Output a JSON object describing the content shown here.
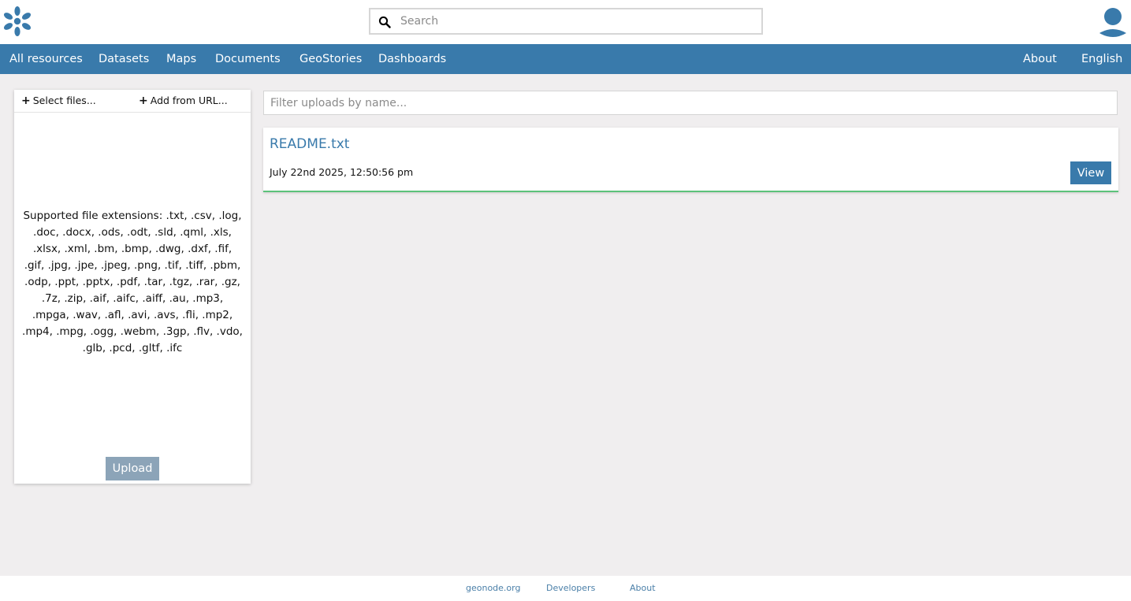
{
  "header": {
    "logo_icon": "geonode-logo-icon",
    "search_placeholder": "Search",
    "search_icon": "search-icon",
    "user_icon": "user-avatar-icon"
  },
  "nav": {
    "left": [
      "All resources",
      "Datasets",
      "Maps",
      "Documents",
      "GeoStories",
      "Dashboards"
    ],
    "right": [
      "About",
      "English"
    ]
  },
  "upload_panel": {
    "select_files": "Select files...",
    "add_from_url": "Add from URL...",
    "supported_extensions": "Supported file extensions: .txt, .csv, .log, .doc, .docx, .ods, .odt, .sld, .qml, .xls, .xlsx, .xml, .bm, .bmp, .dwg, .dxf, .fif, .gif, .jpg, .jpe, .jpeg, .png, .tif, .tiff, .pbm, .odp, .ppt, .pptx, .pdf, .tar, .tgz, .rar, .gz, .7z, .zip, .aif, .aifc, .aiff, .au, .mp3, .mpga, .wav, .afl, .avi, .avs, .fli, .mp2, .mp4, .mpg, .ogg, .webm, .3gp, .flv, .vdo, .glb, .pcd, .gltf, .ifc",
    "upload_label": "Upload"
  },
  "filter": {
    "placeholder": "Filter uploads by name..."
  },
  "uploads": [
    {
      "name": "README.txt",
      "date": "July 22nd 2025, 12:50:56 pm",
      "action": "View",
      "status_color": "#5cc27b"
    }
  ],
  "footer": {
    "links": [
      "geonode.org",
      "Developers",
      "About"
    ]
  },
  "colors": {
    "brand": "#397aab",
    "page_background": "#f0eeef",
    "upload_disabled": "#8ca4b8",
    "success": "#5cc27b"
  }
}
